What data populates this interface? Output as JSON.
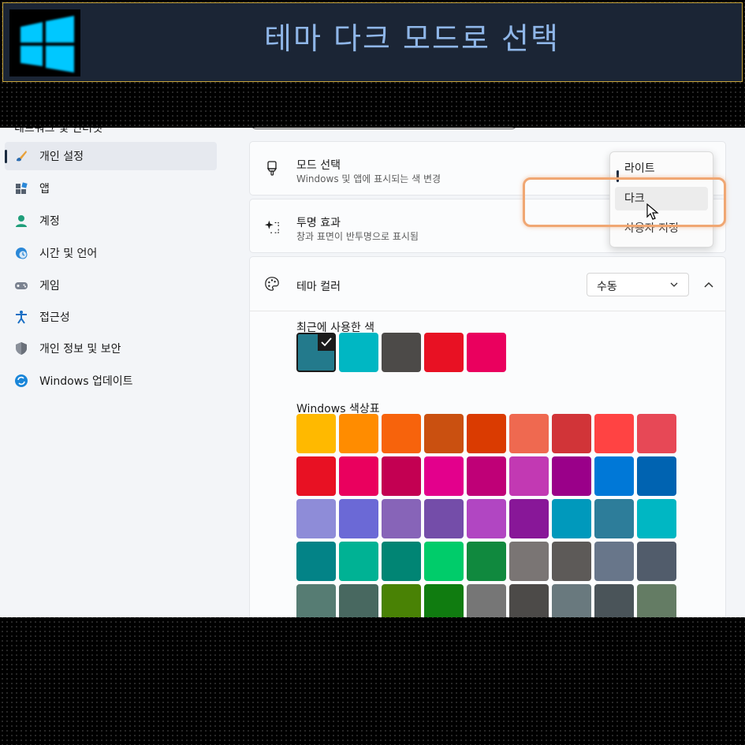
{
  "banner": {
    "title": "테마 다크 모드로 선택",
    "logo_icon": "windows-logo-icon",
    "logo_color": "#00c8ff"
  },
  "sidebar": {
    "partial_item": "네트워크 및 인터넷",
    "items": [
      {
        "label": "개인 설정",
        "icon": "paintbrush-icon",
        "active": true
      },
      {
        "label": "앱",
        "icon": "apps-icon"
      },
      {
        "label": "계정",
        "icon": "person-icon"
      },
      {
        "label": "시간 및 언어",
        "icon": "clock-globe-icon"
      },
      {
        "label": "게임",
        "icon": "gamepad-icon"
      },
      {
        "label": "접근성",
        "icon": "accessibility-icon"
      },
      {
        "label": "개인 정보 및 보안",
        "icon": "shield-icon"
      },
      {
        "label": "Windows 업데이트",
        "icon": "update-icon"
      }
    ]
  },
  "mode": {
    "title": "모드 선택",
    "subtitle": "Windows 및 앱에 표시되는 색 변경",
    "options": [
      "라이트",
      "다크",
      "사용자 지정"
    ]
  },
  "transparency": {
    "title": "투명 효과",
    "subtitle": "창과 표면이 반투명으로 표시됨"
  },
  "theme_color": {
    "title": "테마 컬러",
    "select_value": "수동",
    "recent_label": "최근에 사용한 색",
    "recent_colors": [
      "#237a8c",
      "#00b7c3",
      "#4c4a48",
      "#e81123",
      "#ea005e"
    ],
    "windows_label": "Windows 색상표",
    "palette": [
      [
        "#ffb900",
        "#ff8c00",
        "#f7630c",
        "#ca5010",
        "#da3b01",
        "#ef6950",
        "#d13438",
        "#ff4343",
        "#e74856"
      ],
      [
        "#e81123",
        "#ea005e",
        "#c30052",
        "#e3008c",
        "#bf0077",
        "#c239b3",
        "#9a0089",
        "#0078d7",
        "#0063b1"
      ],
      [
        "#8e8cd8",
        "#6b69d6",
        "#8764b8",
        "#744da9",
        "#b146c2",
        "#881798",
        "#0099bc",
        "#2d7d9a",
        "#00b7c3"
      ],
      [
        "#038387",
        "#00b294",
        "#018574",
        "#00cc6a",
        "#10893e",
        "#7a7574",
        "#5d5a58",
        "#68768a",
        "#515c6b"
      ],
      [
        "#567c73",
        "#486860",
        "#498205",
        "#107c10",
        "#767676",
        "#4c4a48",
        "#69797e",
        "#4a5459",
        "#647c64"
      ]
    ]
  },
  "colors": {
    "accent_dark": "#1b2b40",
    "highlight": "#f0a773",
    "banner_bg": "#1b2535",
    "banner_border": "#c9a53a"
  }
}
